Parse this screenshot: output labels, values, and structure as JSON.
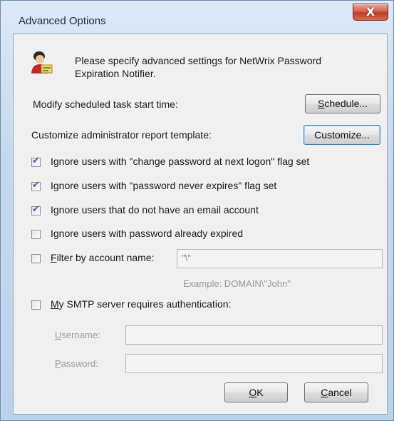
{
  "window": {
    "title": "Advanced Options",
    "close_label": "X"
  },
  "intro": {
    "line1": "Please specify advanced settings for NetWrix Password",
    "line2": "Expiration Notifier."
  },
  "schedule": {
    "label": "Modify scheduled task start time:",
    "button_pre": "",
    "button_ul": "S",
    "button_post": "chedule..."
  },
  "customize": {
    "label": "Customize administrator report template:",
    "button": "Customize..."
  },
  "options": [
    {
      "label": "Ignore users with \"change password at next logon\" flag set",
      "checked": true
    },
    {
      "label": "Ignore users with \"password never expires\" flag set",
      "checked": true
    },
    {
      "label": "Ignore users that do not have an email account",
      "checked": true
    },
    {
      "label": "Ignore users with password already expired",
      "checked": false
    }
  ],
  "filter": {
    "label_ul": "F",
    "label_rest": "ilter by account name:",
    "checked": false,
    "value": "\"\\\"",
    "example": "Example: DOMAIN\\\"John\""
  },
  "smtp": {
    "label_ul": "M",
    "label_rest": "y SMTP server requires authentication:",
    "checked": false,
    "username_ul": "U",
    "username_rest": "sername:",
    "username_value": "",
    "password_ul": "P",
    "password_rest": "assword:",
    "password_value": ""
  },
  "footer": {
    "ok_ul": "O",
    "ok_rest": "K",
    "cancel_ul": "C",
    "cancel_rest": "ancel"
  }
}
